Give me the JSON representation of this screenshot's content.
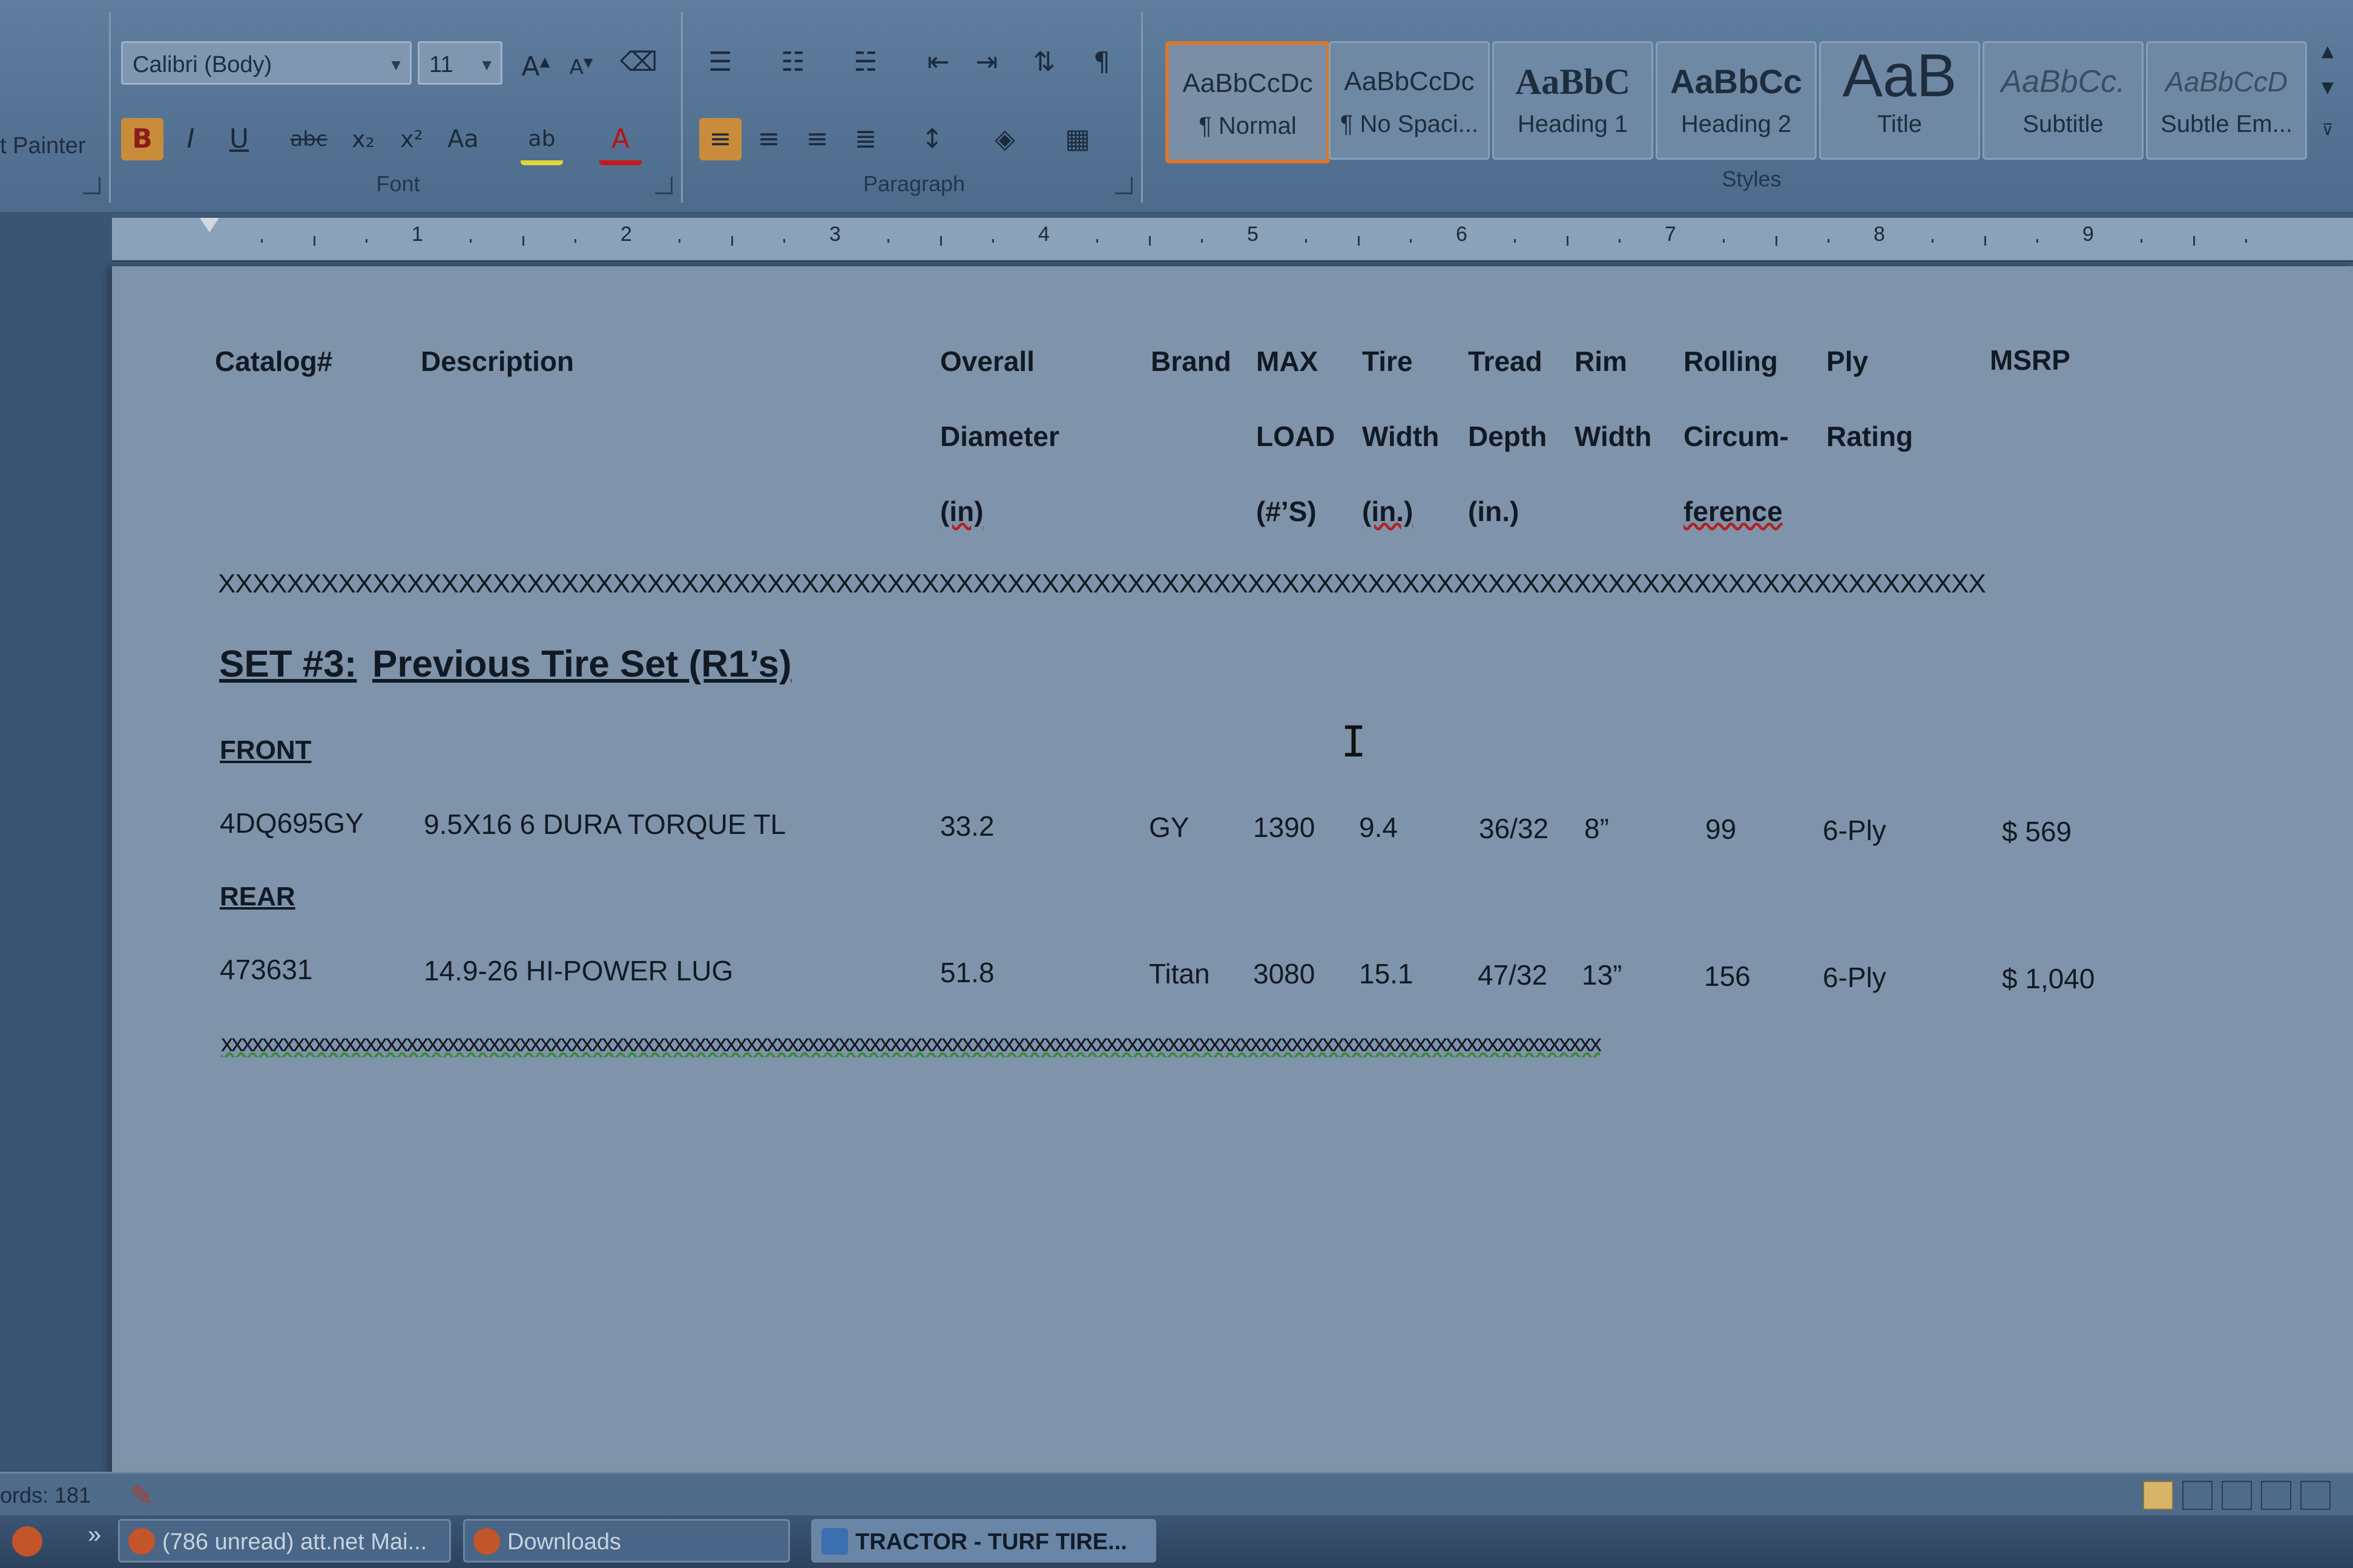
{
  "ribbon": {
    "clipboard": {
      "format_painter": "t Painter"
    },
    "font": {
      "label": "Font",
      "font_name": "Calibri (Body)",
      "font_size": "11",
      "buttons": [
        "B",
        "I",
        "U",
        "abc",
        "x₂",
        "x²",
        "Aa"
      ]
    },
    "paragraph": {
      "label": "Paragraph"
    },
    "styles": {
      "label": "Styles",
      "items": [
        {
          "sample": "AaBbCcDc",
          "name": "¶ Normal"
        },
        {
          "sample": "AaBbCcDc",
          "name": "¶ No Spaci..."
        },
        {
          "sample": "AaBbC",
          "name": "Heading 1"
        },
        {
          "sample": "AaBbCc",
          "name": "Heading 2"
        },
        {
          "sample": "AaB",
          "name": "Title"
        },
        {
          "sample": "AaBbCc.",
          "name": "Subtitle"
        },
        {
          "sample": "AaBbCcD",
          "name": "Subtle Em..."
        }
      ]
    }
  },
  "ruler": {
    "numbers": [
      "1",
      "2",
      "3",
      "4",
      "5",
      "6",
      "7",
      "8",
      "9"
    ]
  },
  "document": {
    "headers": {
      "catalog": "Catalog#",
      "description": "Description",
      "overall": [
        "Overall",
        "Diameter",
        "(in)"
      ],
      "brand": "Brand",
      "max": [
        "MAX",
        "LOAD",
        "(#’S)"
      ],
      "tire": [
        "Tire",
        "Width",
        "(in.)"
      ],
      "tread": [
        "Tread",
        "Depth",
        "(in.)"
      ],
      "rim": [
        "Rim",
        "Width"
      ],
      "rolling": [
        "Rolling",
        "Circum-",
        "ference"
      ],
      "ply": [
        "Ply",
        "Rating"
      ],
      "msrp": "MSRP"
    },
    "separator_upper": "XXXXXXXXXXXXXXXXXXXXXXXXXXXXXXXXXXXXXXXXXXXXXXXXXXXXXXXXXXXXXXXXXXXXXXXXXXXXXXXXXXXXXXXXXXXXXXXXXXXXXXX",
    "set_label": "SET #3:",
    "set_title": "Previous Tire Set (R1’s)",
    "front_label": "FRONT",
    "rear_label": "REAR",
    "rows": [
      {
        "catalog": "4DQ695GY",
        "description": "9.5X16 6 DURA TORQUE TL",
        "diameter": "33.2",
        "brand": "GY",
        "load": "1390",
        "width": "9.4",
        "tread": "36/32",
        "rim": "8”",
        "circ": "99",
        "ply": "6-Ply",
        "msrp": "$ 569"
      },
      {
        "catalog": "473631",
        "description": "14.9-26 HI-POWER LUG",
        "diameter": "51.8",
        "brand": "Titan",
        "load": "3080",
        "width": "15.1",
        "tread": "47/32",
        "rim": "13”",
        "circ": "156",
        "ply": "6-Ply",
        "msrp": "$ 1,040"
      }
    ],
    "separator_lower": "xxxxxxxxxxxxxxxxxxxxxxxxxxxxxxxxxxxxxxxxxxxxxxxxxxxxxxxxxxxxxxxxxxxxxxxxxxxxxxxxxxxxxxxxxxxxxxxxxxxxxxxxxxxxxxxxxxxxxxxxxxxxxxxxxxxxxx"
  },
  "status": {
    "words": "ords: 181"
  },
  "taskbar": {
    "items": [
      "»",
      "(786 unread) att.net Mai...",
      "Downloads",
      "TRACTOR - TURF TIRE..."
    ]
  }
}
